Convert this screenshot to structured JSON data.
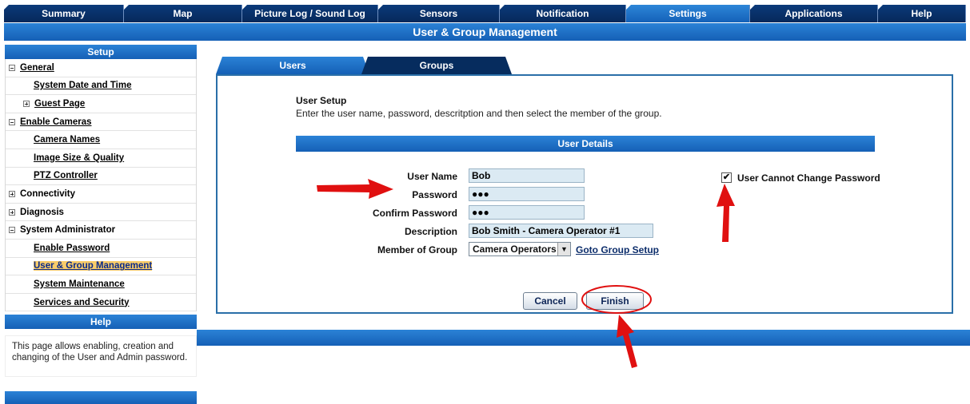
{
  "topnav": {
    "tabs": [
      {
        "label": "Summary"
      },
      {
        "label": "Map"
      },
      {
        "label": "Picture Log / Sound Log"
      },
      {
        "label": "Sensors"
      },
      {
        "label": "Notification"
      },
      {
        "label": "Settings",
        "active": true
      },
      {
        "label": "Applications"
      },
      {
        "label": "Help"
      }
    ]
  },
  "page_title": "User & Group Management",
  "sidebar": {
    "header": "Setup",
    "items": [
      {
        "label": "General"
      },
      {
        "label": "System Date and Time"
      },
      {
        "label": "Guest Page"
      },
      {
        "label": "Enable Cameras"
      },
      {
        "label": "Camera Names"
      },
      {
        "label": "Image Size & Quality"
      },
      {
        "label": "PTZ Controller"
      },
      {
        "label": "Connectivity"
      },
      {
        "label": "Diagnosis"
      },
      {
        "label": "System Administrator"
      },
      {
        "label": "Enable Password"
      },
      {
        "label": "User & Group Management"
      },
      {
        "label": "System Maintenance"
      },
      {
        "label": "Services and Security"
      }
    ],
    "help_header": "Help",
    "help_text": "This page allows enabling, creation and changing of the User and Admin password."
  },
  "content_tabs": {
    "users": "Users",
    "groups": "Groups"
  },
  "user_setup": {
    "title": "User Setup",
    "description": "Enter the user name, password, descritption and then select the member of the group.",
    "details_header": "User Details"
  },
  "form": {
    "username_label": "User Name",
    "username_value": "Bob",
    "password_label": "Password",
    "password_value": "●●●",
    "confirm_label": "Confirm Password",
    "confirm_value": "●●●",
    "description_label": "Description",
    "description_value": "Bob Smith - Camera Operator #1",
    "group_label": "Member of Group",
    "group_value": "Camera Operators",
    "goto_group_link": "Goto Group Setup",
    "cannot_change_label": "User Cannot Change Password",
    "cannot_change_checked": "✔"
  },
  "buttons": {
    "cancel": "Cancel",
    "finish": "Finish"
  },
  "colors": {
    "nav_dark": "#0b3a7a",
    "nav_active": "#2d86d8",
    "annotation_red": "#e01010"
  }
}
